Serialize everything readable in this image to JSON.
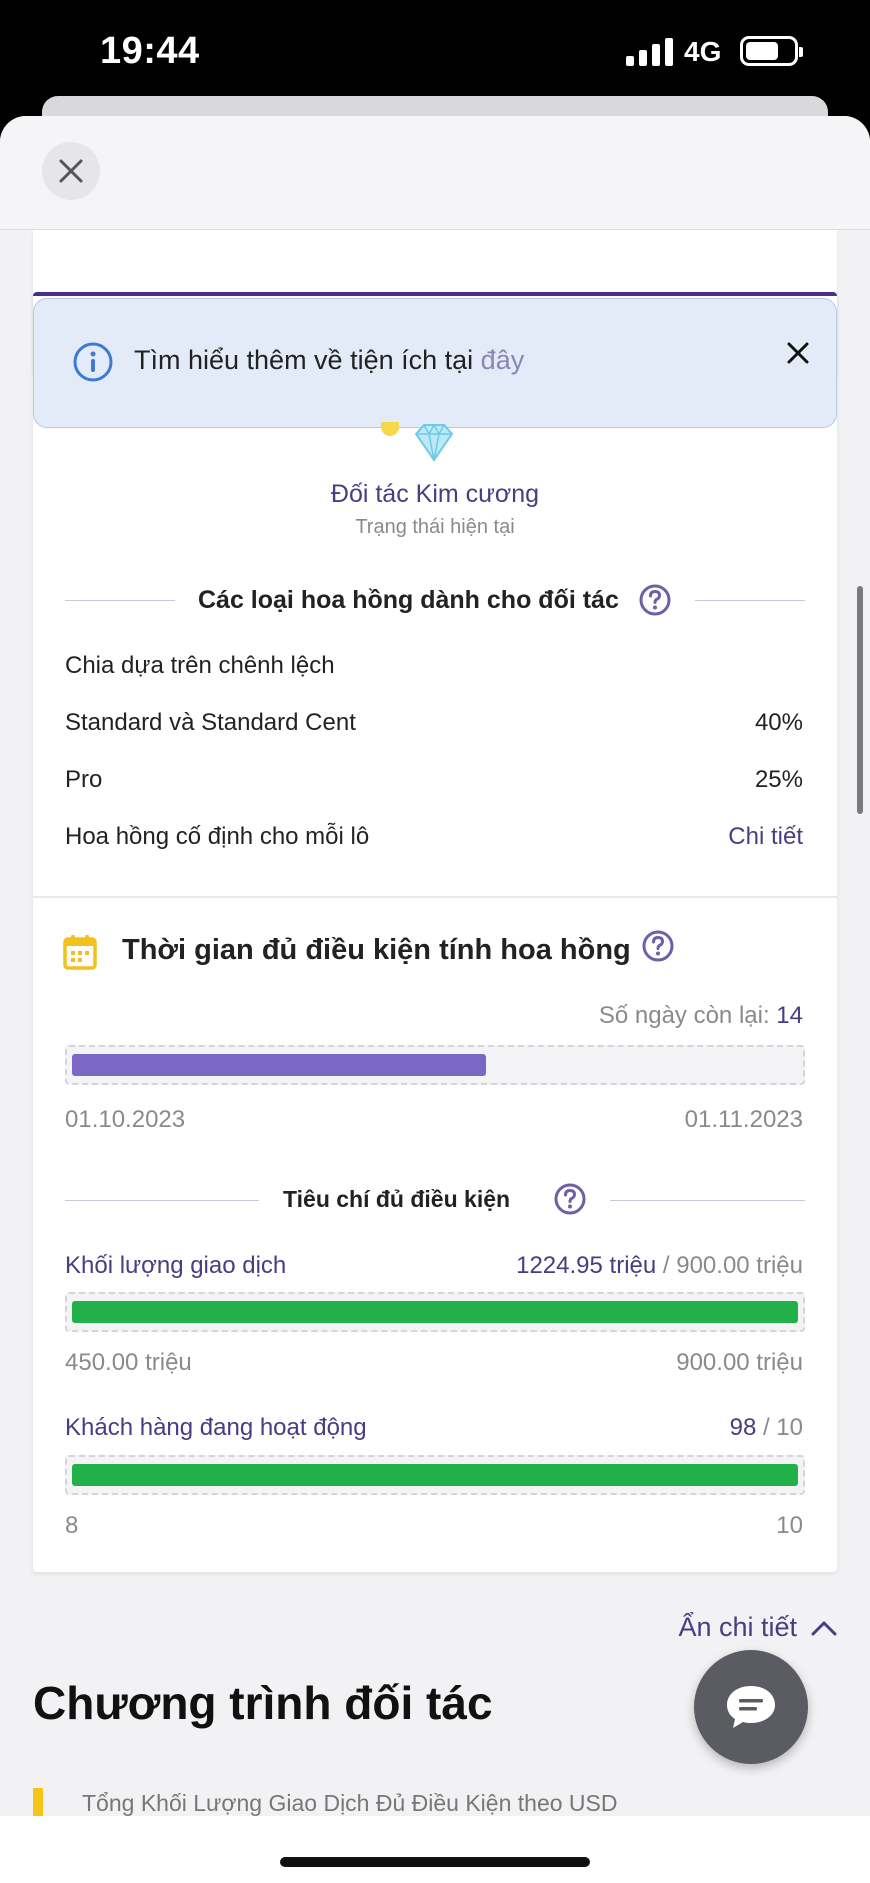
{
  "status_bar": {
    "time": "19:44",
    "network": "4G",
    "battery_level": 0.7
  },
  "banner": {
    "text": "Tìm hiểu thêm về tiện ích tại",
    "link": "đây"
  },
  "tier": {
    "name": "Đối tác Kim cương",
    "subtitle": "Trạng thái hiện tại"
  },
  "commission": {
    "title": "Các loại hoa hồng dành cho đối tác",
    "rows": [
      {
        "label": "Chia dựa trên chênh lệch",
        "value": ""
      },
      {
        "label": "Standard và Standard Cent",
        "value": "40%"
      },
      {
        "label": "Pro",
        "value": "25%"
      },
      {
        "label": "Hoa hồng cố định cho mỗi lô",
        "value": "Chi tiết"
      }
    ]
  },
  "period": {
    "title": "Thời gian đủ điều kiện tính hoa hồng",
    "days_left_label": "Số ngày còn lại:",
    "days_left_value": "14",
    "progress": 0.57,
    "start_date": "01.10.2023",
    "end_date": "01.11.2023",
    "bar_color": "#7b68c6"
  },
  "criteria": {
    "title": "Tiêu chí đủ điều kiện",
    "items": [
      {
        "label": "Khối lượng giao dịch",
        "current": "1224.95 triệu",
        "target": "/ 900.00 triệu",
        "min": "450.00 triệu",
        "max": "900.00 triệu",
        "progress": 1.0
      },
      {
        "label": "Khách hàng đang hoạt động",
        "current": "98",
        "target": "/ 10",
        "min": "8",
        "max": "10",
        "progress": 1.0
      }
    ],
    "bar_color": "#22b04b"
  },
  "footer": {
    "hide_details": "Ẩn chi tiết",
    "program_title": "Chương trình đối tác",
    "program_item": "Tổng Khối Lượng Giao Dịch Đủ Điều Kiện theo USD"
  },
  "icons": {
    "close": "close-icon",
    "info": "info-icon",
    "help": "help-icon",
    "calendar": "calendar-icon",
    "diamond": "diamond-icon",
    "chat": "chat-icon",
    "chevron": "chevron-up-icon"
  },
  "colors": {
    "brand_purple": "#4a3c82",
    "banner_bg": "#e4ebf8",
    "accent_yellow": "#f5c518"
  }
}
